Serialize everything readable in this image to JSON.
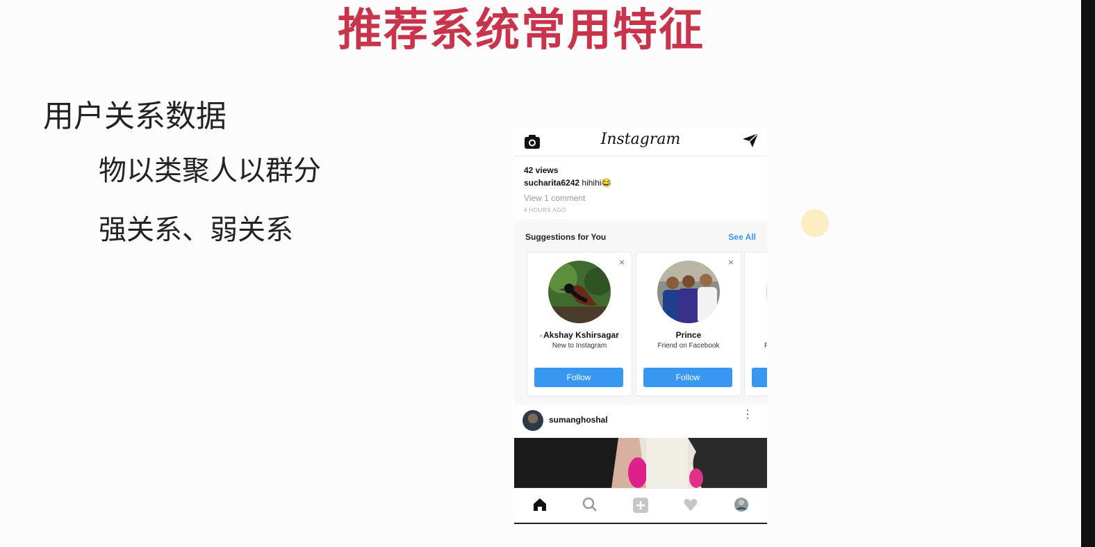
{
  "slide": {
    "title": "推荐系统常用特征",
    "bullet_main": "用户关系数据",
    "bullet_sub_1": "物以类聚人以群分",
    "bullet_sub_2": "强关系、弱关系"
  },
  "phone": {
    "app_title": "Instagram",
    "post": {
      "views": "42 views",
      "username": "sucharita6242",
      "caption_text": " hihihi😂",
      "view_comments": "View 1 comment",
      "time_ago": "4 HOURS AGO"
    },
    "suggestions": {
      "title": "Suggestions for You",
      "see_all": "See All",
      "close_glyph": "×",
      "cards": [
        {
          "name": "Akshay Kshirsagar",
          "subtitle": "New to Instagram",
          "button": "Follow"
        },
        {
          "name": "Prince",
          "subtitle": "Friend on Facebook",
          "button": "Follow"
        },
        {
          "name": "",
          "subtitle": "F",
          "button": "Follow"
        }
      ]
    },
    "next_post": {
      "username": "sumanghoshal",
      "more_glyph": "⋮"
    },
    "bottom_nav": [
      "home-icon",
      "search-icon",
      "add-icon",
      "heart-icon",
      "profile-icon"
    ]
  },
  "colors": {
    "title_red": "#c8344c",
    "follow_blue": "#3897f0",
    "link_blue": "#3897f0"
  }
}
